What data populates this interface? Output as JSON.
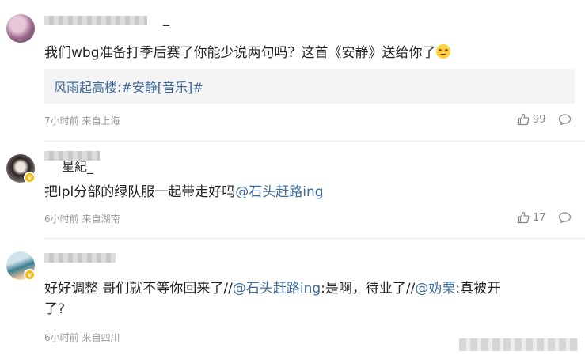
{
  "comments": [
    {
      "username": "_",
      "text": "我们wbg准备打季后赛了你能少说两句吗？这首《安静》送给你了",
      "emoji": "smile-emoji",
      "quote": "风雨起高楼:#安静[音乐]#",
      "time": "7小时前",
      "location": "来自上海",
      "likes": "99"
    },
    {
      "username": "星紀_",
      "text_plain": "把lpl分部的绿队服一起带走好吗",
      "mention": "@石头赶路ing",
      "time": "6小时前",
      "location": "来自湖南",
      "likes": "17"
    },
    {
      "username": "",
      "text_part1": "好好调整 哥们就不等你回来了//",
      "mention1": "@石头赶路ing",
      "text_part2": ":是啊，待业了//",
      "mention2": "@妫栗",
      "text_part3": ":真被开",
      "text_line2": "了?",
      "time": "6小时前",
      "location": "来自四川"
    }
  ],
  "colors": {
    "mention": "#3d6b9a",
    "meta": "#999999",
    "badge": "#f5b914"
  },
  "icons": [
    "thumb-up-icon",
    "comment-icon",
    "vip-badge-icon"
  ]
}
